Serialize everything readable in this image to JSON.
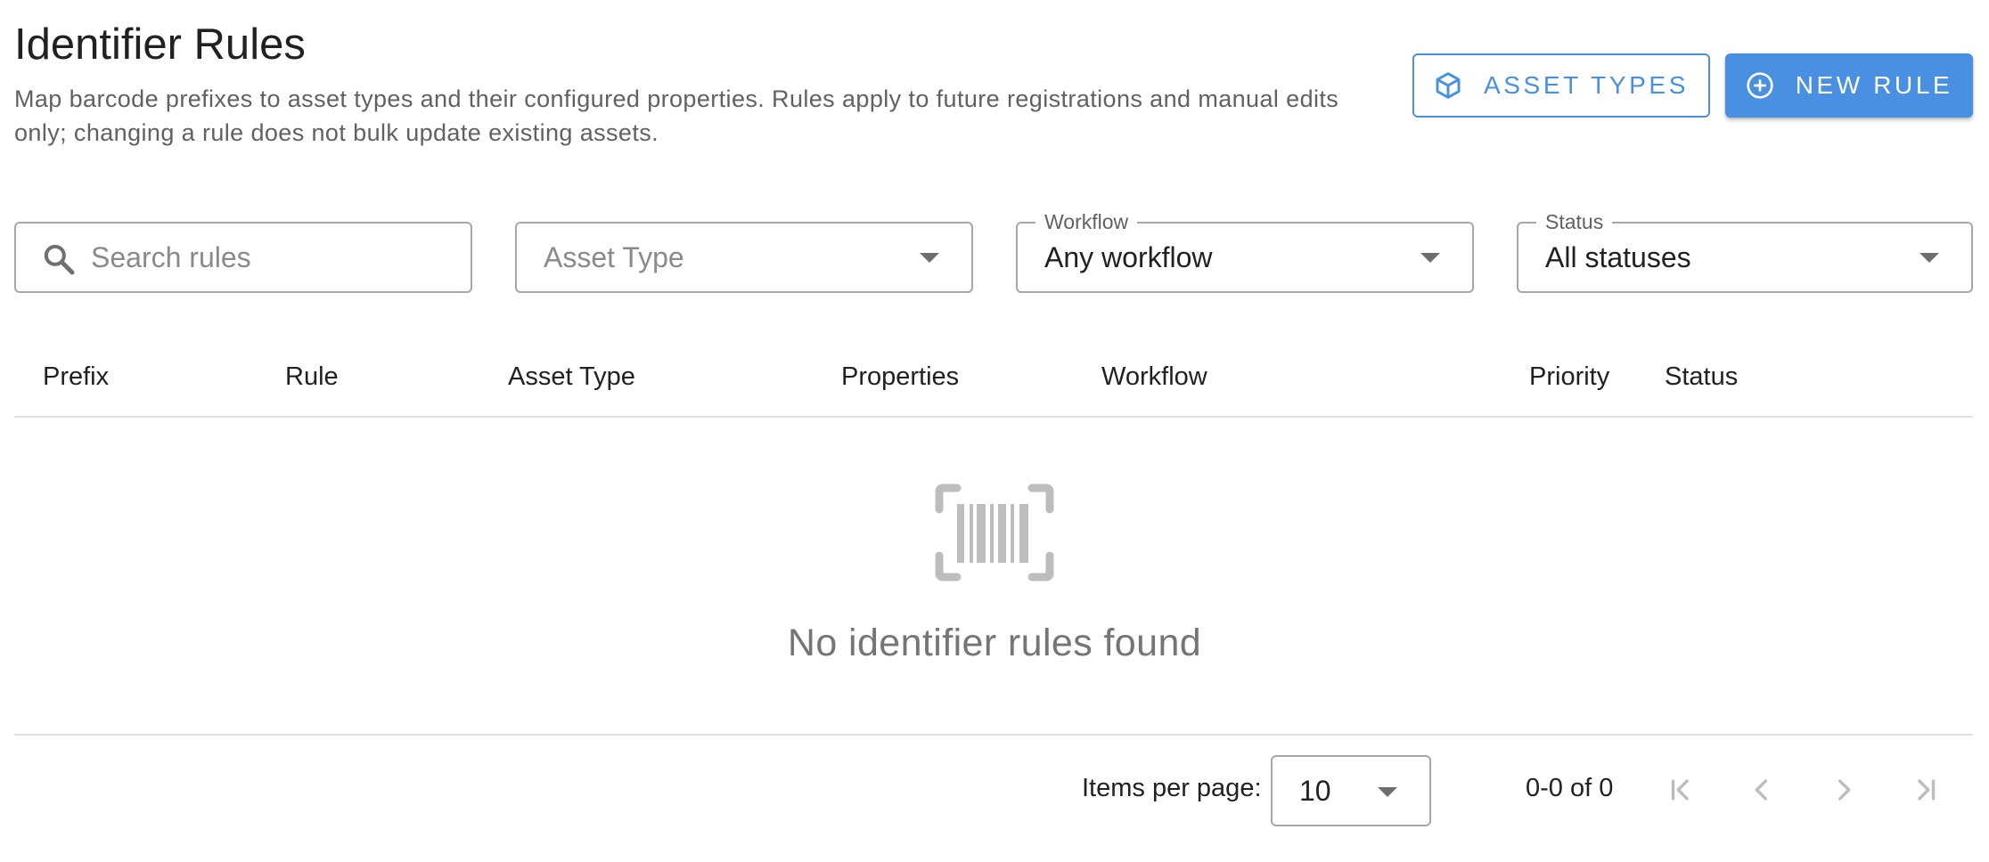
{
  "header": {
    "title": "Identifier Rules",
    "subtitle": "Map barcode prefixes to asset types and their configured properties. Rules apply to future registrations and manual edits only; changing a rule does not bulk update existing assets.",
    "asset_types_button": "ASSET TYPES",
    "new_rule_button": "NEW RULE",
    "asset_types_icon": "cube-icon",
    "new_rule_icon": "plus-circle-icon"
  },
  "filters": {
    "search": {
      "placeholder": "Search rules",
      "value": ""
    },
    "asset_type": {
      "placeholder": "Asset Type",
      "value": ""
    },
    "workflow": {
      "label": "Workflow",
      "value": "Any workflow"
    },
    "status": {
      "label": "Status",
      "value": "All statuses"
    }
  },
  "table": {
    "columns": [
      "Prefix",
      "Rule",
      "Asset Type",
      "Properties",
      "Workflow",
      "Priority",
      "Status"
    ],
    "rows": [],
    "empty_icon": "barcode-scan-icon",
    "empty_message": "No identifier rules found"
  },
  "pagination": {
    "items_per_page_label": "Items per page:",
    "items_per_page": "10",
    "range": "0-0 of 0"
  },
  "colors": {
    "accent": "#4a90e2",
    "text": "#212121",
    "muted": "#757575",
    "border": "#a7a7a7",
    "divider": "#e0e0e0"
  }
}
